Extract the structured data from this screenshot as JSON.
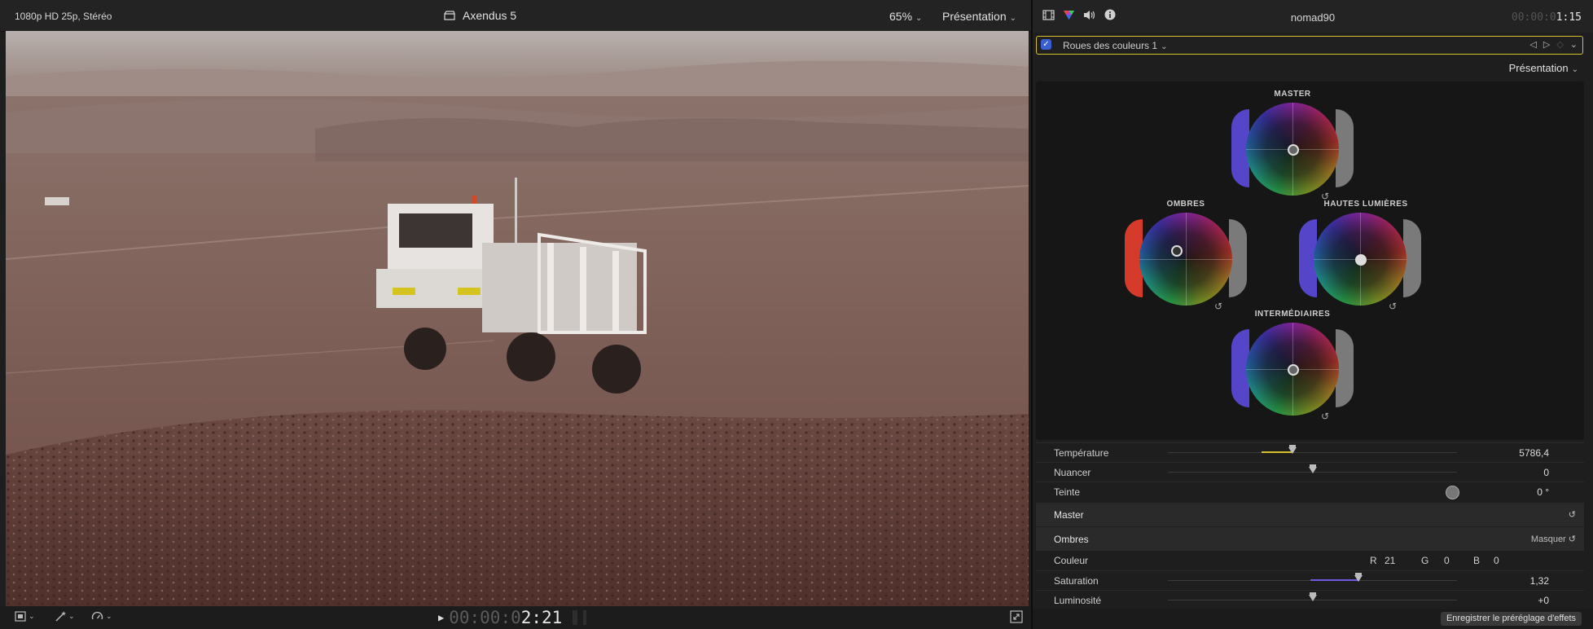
{
  "viewer": {
    "format": "1080p HD 25p, Stéréo",
    "project_title": "Axendus 5",
    "zoom": "65%",
    "view_label": "Présentation",
    "timecode_dim": "00:00:0",
    "timecode_main": "2:21"
  },
  "inspector": {
    "clip_name": "nomad90",
    "duration_dim": "00:00:0",
    "duration_main": "1:15",
    "effect_name": "Roues des couleurs 1",
    "effect_enabled": true,
    "view_label": "Présentation",
    "wheels": {
      "master": "MASTER",
      "shadows": "OMBRES",
      "highlights": "HAUTES LUMIÈRES",
      "midtones": "INTERMÉDIAIRES"
    },
    "params": {
      "temperature": {
        "label": "Température",
        "value": "5786,4",
        "level": 0.43
      },
      "tint": {
        "label": "Nuancer",
        "value": "0",
        "level": 0.5
      },
      "hue": {
        "label": "Teinte",
        "value": "0 °"
      }
    },
    "sections": {
      "master": "Master",
      "shadows": "Ombres",
      "hide_label": "Masquer"
    },
    "shadows_params": {
      "color_label": "Couleur",
      "r_label": "R",
      "r": "21",
      "g_label": "G",
      "g": "0",
      "b_label": "B",
      "b": "0",
      "saturation": {
        "label": "Saturation",
        "value": "1,32",
        "level": 0.66
      },
      "brightness": {
        "label": "Luminosité",
        "value": "+0",
        "level": 0.5
      }
    },
    "save_label": "Enregistrer le préréglage d'effets"
  },
  "colors": {
    "accent_yellow": "#d6c02b",
    "checkbox_blue": "#3a5fd1"
  }
}
